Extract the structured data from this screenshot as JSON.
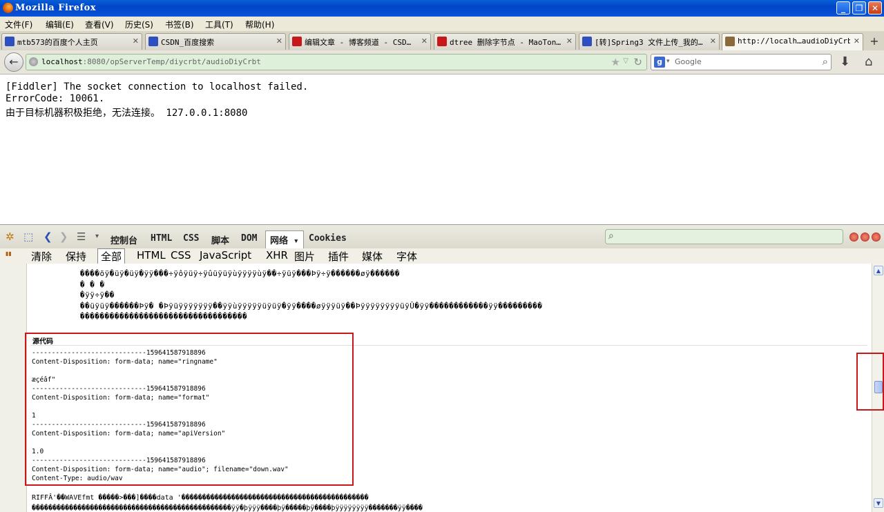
{
  "window": {
    "title": "Mozilla Firefox"
  },
  "menu": [
    "文件(F)",
    "编辑(E)",
    "查看(V)",
    "历史(S)",
    "书签(B)",
    "工具(T)",
    "帮助(H)"
  ],
  "tabs": [
    {
      "label": "mtb573的百度个人主页",
      "icon_color": "#2d4fbf"
    },
    {
      "label": "CSDN_百度搜索",
      "icon_color": "#2d4fbf"
    },
    {
      "label": "编辑文章 - 博客频道 - CSD…",
      "icon_color": "#c8161b"
    },
    {
      "label": "dtree 删除字节点 - MaoTon…",
      "icon_color": "#c8161b"
    },
    {
      "label": "[转]Spring3 文件上传_我的…",
      "icon_color": "#2d4fbf"
    },
    {
      "label": "http://localh…audioDiyCrbt",
      "icon_color": "#8a6a3a"
    }
  ],
  "url": {
    "host": "localhost",
    "path": ":8080/opServerTemp/diycrbt/audioDiyCrbt"
  },
  "search": {
    "placeholder": "Google"
  },
  "page": {
    "line1": "[Fiddler] The socket connection to localhost failed.",
    "line2": "ErrorCode: 10061.",
    "line3": "由于目标机器积极拒绝，无法连接。 127.0.0.1:8080"
  },
  "firebug": {
    "tabs": [
      "控制台",
      "HTML",
      "CSS",
      "脚本",
      "DOM",
      "网络 ▾",
      "Cookies"
    ],
    "subtabs": [
      "清除",
      "保持",
      "全部",
      "HTML",
      "CSS",
      "JavaScript",
      "XHR",
      "图片",
      "插件",
      "媒体",
      "字体"
    ],
    "garbled": [
      "����õÿ�üÿ�üÿ�ÿÿ���÷ÿôÿüÿ÷ÿûüÿüÿùÿÿÿÿùÿ��÷ÿüÿ���Þÿ÷ÿ������øÿ������",
      "�      �      �",
      "�ÿÿ÷ÿ��",
      "��üÿüÿ������Þÿ�  �Þÿüÿÿÿÿÿÿÿ��ÿÿùÿÿÿÿÿüÿüÿ�ÿÿ����øÿÿÿüÿ��ÞÿÿÿÿÿÿÿÿüÿÛ�ÿÿ������������ÿÿ���������",
      "����������������������������������"
    ],
    "source_label": "源代码",
    "source_lines": [
      "-----------------------------159641587918896",
      "Content-Disposition: form-data; name=\"ringname\"",
      "",
      "æçéâf\"",
      "-----------------------------159641587918896",
      "Content-Disposition: form-data; name=\"format\"",
      "",
      "1",
      "-----------------------------159641587918896",
      "Content-Disposition: form-data; name=\"apiVersion\"",
      "",
      "1.0",
      "-----------------------------159641587918896",
      "Content-Disposition: form-data; name=\"audio\"; filename=\"down.wav\"",
      "Content-Type: audio/wav"
    ],
    "bottom1": "RIFFÂ'��WAVEfmt �����>���]����data '���������������������������������������������",
    "bottom2": "������������������������������������������������ÿÿ�þÿÿÿ����þÿ�����þÿ����þÿÿÿÿÿÿÿÿ�������ÿÿ����"
  }
}
